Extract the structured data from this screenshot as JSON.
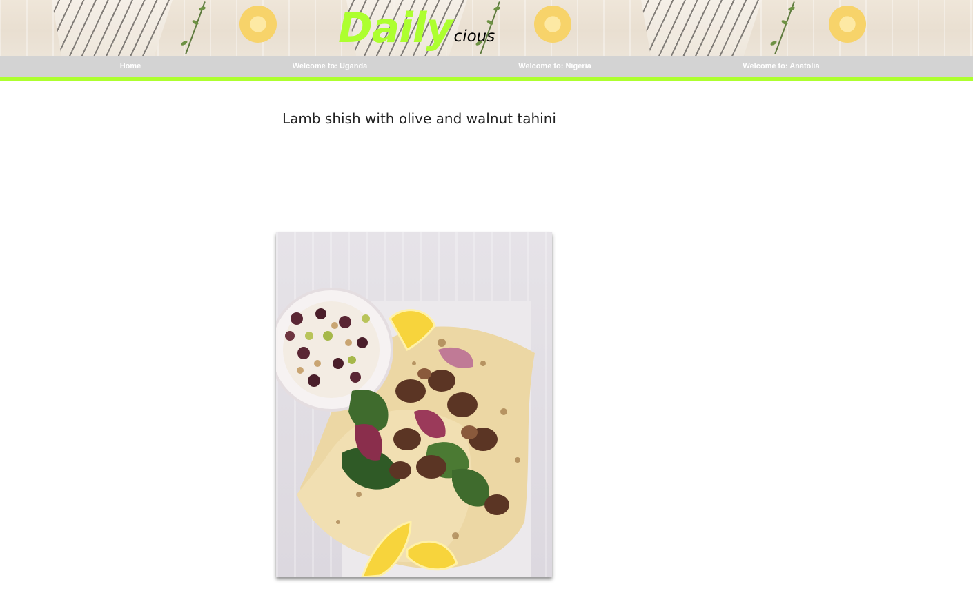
{
  "header": {
    "logo_main": "Daily",
    "logo_sub": "cious"
  },
  "nav": {
    "items": [
      {
        "label": "Home"
      },
      {
        "label": "Welcome to: Uganda"
      },
      {
        "label": "Welcome to: Nigeria"
      },
      {
        "label": "Welcome to: Anatolia"
      }
    ]
  },
  "recipe": {
    "title": "Lamb shish with olive and walnut tahini",
    "image_alt": "Lamb shish on flatbread with salad, lemon wedges and a bowl of olive and walnut tahini"
  },
  "colors": {
    "accent": "#adff2f",
    "nav_bg": "#d3d3d3",
    "nav_text": "#ffffff",
    "title_text": "#222222"
  }
}
